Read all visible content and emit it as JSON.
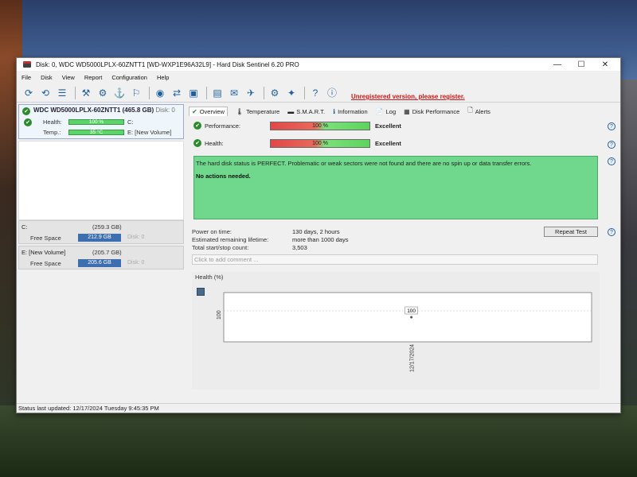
{
  "window": {
    "title": "Disk: 0, WDC WD5000LPLX-60ZNTT1 [WD-WXP1E96A32L9]  -  Hard Disk Sentinel 6.20 PRO",
    "controls": [
      "—",
      "☐",
      "✕"
    ]
  },
  "menu": {
    "items": [
      "File",
      "Disk",
      "View",
      "Report",
      "Configuration",
      "Help"
    ]
  },
  "toolbar": {
    "unregistered_text": "Unregistered version, please register."
  },
  "disk_panel": {
    "title": "WDC WD5000LPLX-60ZNTT1",
    "size": "(465.8 GB)",
    "disk_index": "Disk: 0",
    "health_label": "Health:",
    "health_value": "100 %",
    "health_fraction": 1.0,
    "health_drive": "C:",
    "temp_label": "Temp.:",
    "temp_value": "35 °C",
    "temp_drive": "E: [New Volume]"
  },
  "volumes": [
    {
      "name": "C:",
      "size": "(259.3 GB)",
      "free_label": "Free Space",
      "free": "212.9 GB",
      "disk": "Disk: 0"
    },
    {
      "name": "E: [New Volume]",
      "size": "(205.7 GB)",
      "free_label": "Free Space",
      "free": "205.6 GB",
      "disk": "Disk: 0"
    }
  ],
  "tabs": [
    {
      "label": "Overview",
      "icon": "✔"
    },
    {
      "label": "Temperature",
      "icon": "🌡"
    },
    {
      "label": "S.M.A.R.T.",
      "icon": "▬"
    },
    {
      "label": "Information",
      "icon": "ℹ"
    },
    {
      "label": "Log",
      "icon": "📄"
    },
    {
      "label": "Disk Performance",
      "icon": "▦"
    },
    {
      "label": "Alerts",
      "icon": "🗋"
    }
  ],
  "overview": {
    "performance_label": "Performance:",
    "performance_value": "100 %",
    "performance_fraction": 1.0,
    "performance_rating": "Excellent",
    "health_label": "Health:",
    "health_value": "100 %",
    "health_fraction": 1.0,
    "health_rating": "Excellent",
    "status_text": "The hard disk status is PERFECT. Problematic or weak sectors were not found and there are no spin up or data transfer errors.",
    "actions_text": "No actions needed.",
    "power_on_label": "Power on time:",
    "power_on_value": "130 days, 2 hours",
    "lifetime_label": "Estimated remaining lifetime:",
    "lifetime_value": "more than 1000 days",
    "startstop_label": "Total start/stop count:",
    "startstop_value": "3,503",
    "repeat_test": "Repeat Test",
    "comment_placeholder": "Click to add comment ..."
  },
  "chart_data": {
    "type": "line",
    "title": "Health (%)",
    "x": [
      "12/17/2024"
    ],
    "series": [
      {
        "values": [
          100
        ]
      }
    ],
    "yaxis_tick": "100",
    "data_label": "100"
  },
  "statusbar": {
    "text": "Status last updated: 12/17/2024 Tuesday 9:45:35 PM"
  },
  "colors": {
    "status_green": "#6fd88c",
    "bar_red": "#e04848",
    "bar_green": "#5cd45c",
    "unregistered_red": "#d01818",
    "volume_bar_blue": "#3d6fb0"
  }
}
